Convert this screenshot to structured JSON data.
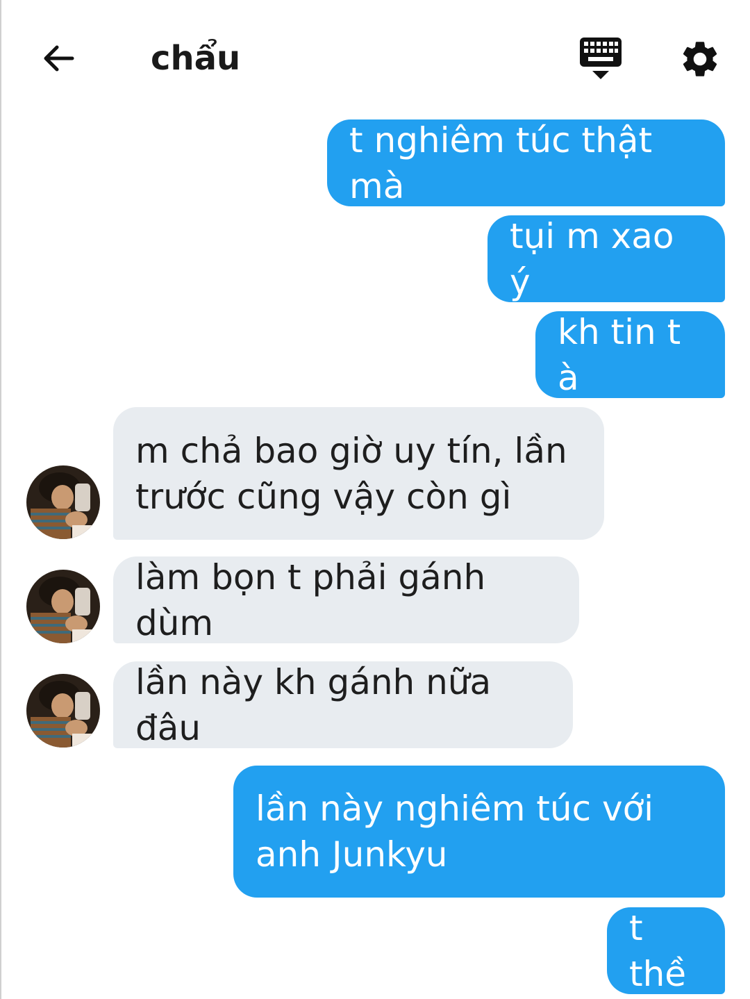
{
  "header": {
    "title": "chẩu",
    "back_icon": "arrow-left-icon",
    "keyboard_icon": "keyboard-icon",
    "settings_icon": "gear-icon"
  },
  "colors": {
    "sent_bubble": "#22a0f0",
    "received_bubble": "#e8ecf0"
  },
  "messages": [
    {
      "direction": "sent",
      "text": "t nghiêm túc thật mà"
    },
    {
      "direction": "sent",
      "text": "tụi m xao ý"
    },
    {
      "direction": "sent",
      "text": "kh tin t à"
    },
    {
      "direction": "received",
      "text_lines": [
        "m chả bao giờ uy tín, lần",
        "trước cũng vậy còn gì"
      ]
    },
    {
      "direction": "received",
      "text": "làm bọn t phải gánh dùm"
    },
    {
      "direction": "received",
      "text": "lần này kh gánh nữa đâu"
    },
    {
      "direction": "sent",
      "text_lines": [
        "lần này nghiêm túc với",
        "anh Junkyu"
      ]
    },
    {
      "direction": "sent",
      "text": "t thề"
    }
  ]
}
